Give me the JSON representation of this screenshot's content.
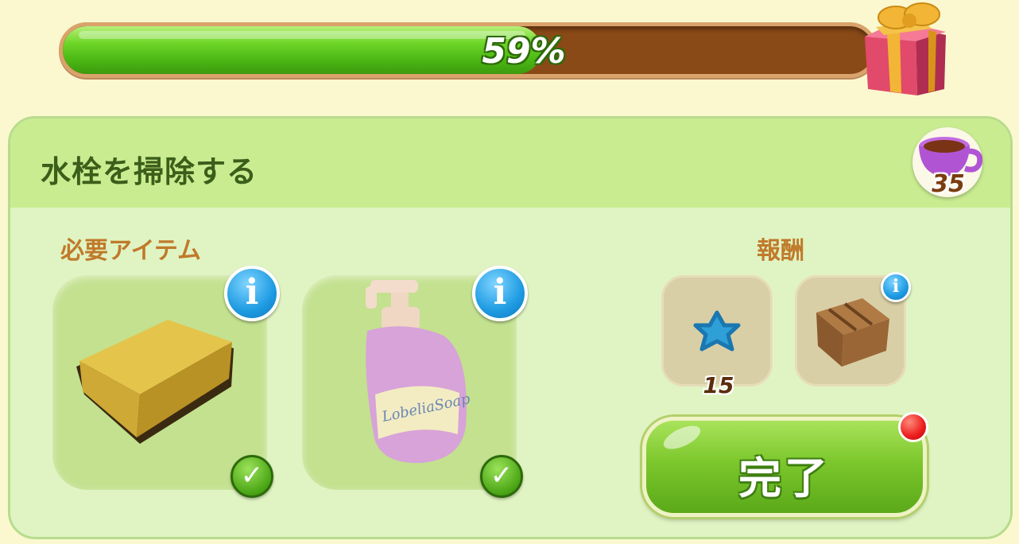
{
  "progress": {
    "percent_text": "59%",
    "fraction": 0.59
  },
  "task": {
    "title": "水栓を掃除する",
    "energy_cost": "35"
  },
  "required": {
    "label": "必要アイテム",
    "items": [
      {
        "name": "sponge",
        "checked": true
      },
      {
        "name": "soap-bottle",
        "bottle_text": "LobeliaSoap",
        "checked": true
      }
    ]
  },
  "rewards": {
    "label": "報酬",
    "items": [
      {
        "name": "blue-star",
        "count": "15"
      },
      {
        "name": "wooden-crate"
      }
    ]
  },
  "complete_button": {
    "label": "完了"
  },
  "colors": {
    "progress_fill": "#5cc21b",
    "progress_track": "#8a4a17",
    "header": "#c9ec91",
    "panel": "#e0f4c3"
  }
}
